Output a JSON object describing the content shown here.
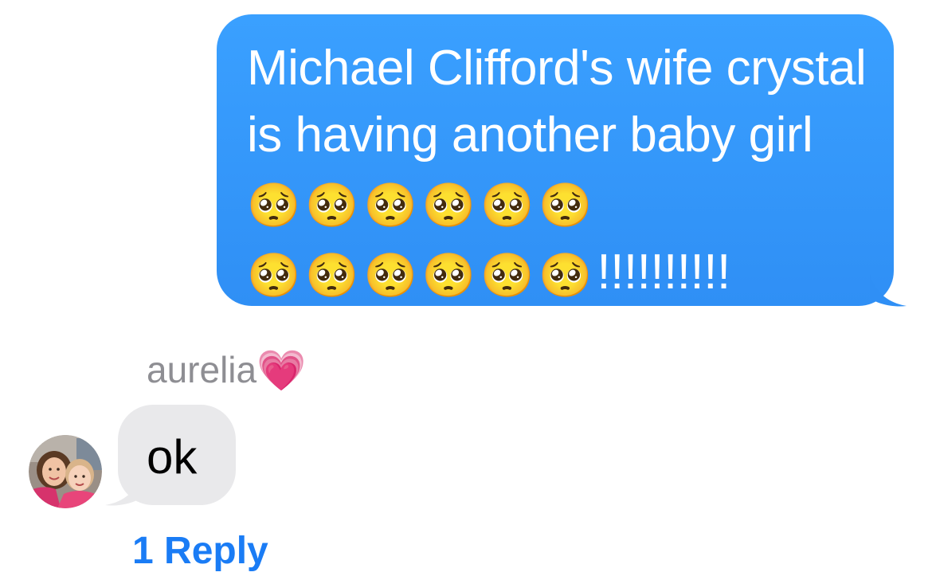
{
  "outgoing_message": {
    "text": "Michael Clifford's wife crystal is having another baby girl",
    "emoji_line_1": "🥺🥺🥺🥺🥺🥺",
    "emoji_line_2": "🥺🥺🥺🥺🥺🥺",
    "exclamations": "!!!!!!!!!!",
    "bubble_color": "#3aa0ff",
    "emoji_icon": "pleading-face-emoji"
  },
  "incoming_message": {
    "sender_name": "aurelia",
    "sender_emoji": "💗",
    "text": "ok",
    "bubble_color": "#e9e9eb",
    "avatar_icon": "contact-avatar-photo"
  },
  "thread": {
    "reply_label": "1 Reply",
    "link_color": "#1a7cf5"
  }
}
